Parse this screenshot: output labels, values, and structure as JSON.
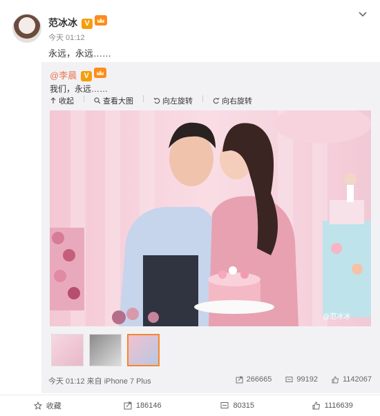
{
  "post": {
    "author": "范冰冰",
    "verified_badge": "V",
    "time": "今天 01:12",
    "text": "永远，永远……"
  },
  "repost": {
    "author": "@李晨",
    "verified_badge": "V",
    "text": "我们，永远……",
    "tools": {
      "collapse": "收起",
      "view_large": "查看大图",
      "rotate_left": "向左旋转",
      "rotate_right": "向右旋转"
    },
    "watermark": "@范冰冰",
    "source": "今天 01:12 来自 iPhone 7 Plus",
    "stats": {
      "reposts": "266665",
      "comments": "99192",
      "likes": "1142067"
    }
  },
  "actions": {
    "favorite": "收藏",
    "repost": "186146",
    "comment": "80315",
    "like": "1116639"
  },
  "colors": {
    "accent": "#eb7350",
    "thumb_selected": "#f6872a"
  }
}
